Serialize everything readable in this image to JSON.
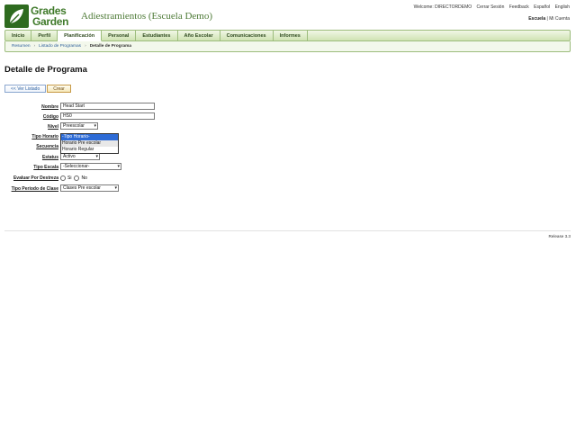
{
  "brand": {
    "line1": "Grades",
    "line2": "Garden"
  },
  "app_title": "Adiestramientos (Escuela Demo)",
  "top_links": {
    "welcome": "Welcome: DIRECTORDEMO",
    "logout": "Cerrar Sesión",
    "feedback": "Feedback",
    "spanish": "Español",
    "english": "English"
  },
  "school_links": {
    "school": "Escuela",
    "account": "| Mi Cuenta"
  },
  "nav": {
    "tabs": [
      {
        "label": "Inicio"
      },
      {
        "label": "Perfil"
      },
      {
        "label": "Planificación"
      },
      {
        "label": "Personal"
      },
      {
        "label": "Estudiantes"
      },
      {
        "label": "Año Escolar"
      },
      {
        "label": "Comunicaciones"
      },
      {
        "label": "Informes"
      }
    ],
    "active": "Planificación"
  },
  "breadcrumb": {
    "items": [
      "Resumen",
      "Listado de Programas",
      "Detalle de Programa"
    ]
  },
  "page_title": "Detalle de Programa",
  "buttons": {
    "listado": "<< Ver Listado",
    "crear": "Crear"
  },
  "form": {
    "nombre": {
      "label": "Nombre",
      "value": "Head Start"
    },
    "codigo": {
      "label": "Código",
      "value": "HS0"
    },
    "nivel": {
      "label": "Nivel",
      "value": "Preescolar"
    },
    "tipo_horario": {
      "label": "Tipo Horario",
      "options": [
        "-Tipo Horario-",
        "Horario Pre escolar",
        "Horario Regular"
      ]
    },
    "secuencia": {
      "label": "Secuencia"
    },
    "estatus": {
      "label": "Estatus",
      "value": "Activo"
    },
    "tipo_escala": {
      "label": "Tipo Escala",
      "value": "-Seleccionar-"
    },
    "evaluar": {
      "label": "Evaluar Por Destreza",
      "si": "Si",
      "no": "No"
    },
    "periodo": {
      "label": "Tipo Periodo de Clase",
      "value": "Clases Pre escolar"
    }
  },
  "release": "Release 3.3",
  "colors": {
    "brand_green": "#3f7a2a",
    "nav_bg": "#cfe3b3",
    "link_blue": "#2b5d9a",
    "selected_blue": "#2d6bd6"
  }
}
